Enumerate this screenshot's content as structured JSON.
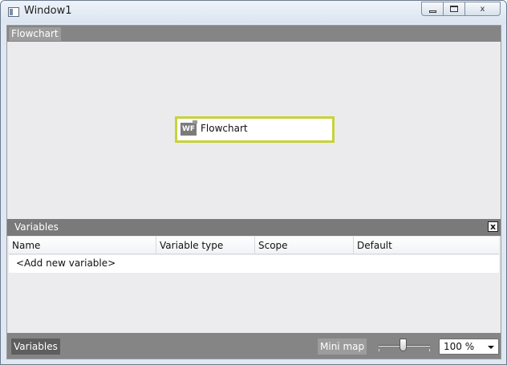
{
  "window": {
    "title": "Window1",
    "app_icon": "window-icon",
    "controls": [
      "minimize-icon",
      "maximize-icon",
      "close-icon"
    ],
    "close_glyph": "x"
  },
  "designer": {
    "breadcrumb": "Flowchart",
    "activity": {
      "icon_text": "WF",
      "label": "Flowchart",
      "highlight_color": "#c7d23a"
    }
  },
  "variables_panel": {
    "title": "Variables",
    "close_glyph": "x",
    "columns": [
      "Name",
      "Variable type",
      "Scope",
      "Default"
    ],
    "add_row_text": "<Add new variable>"
  },
  "status_bar": {
    "variables_label": "Variables",
    "minimap_label": "Mini map",
    "zoom_value": "100 %",
    "zoom_slider_level": 0.45
  },
  "colors": {
    "toolbar_gray": "#858585",
    "canvas_bg": "#ebebee"
  }
}
